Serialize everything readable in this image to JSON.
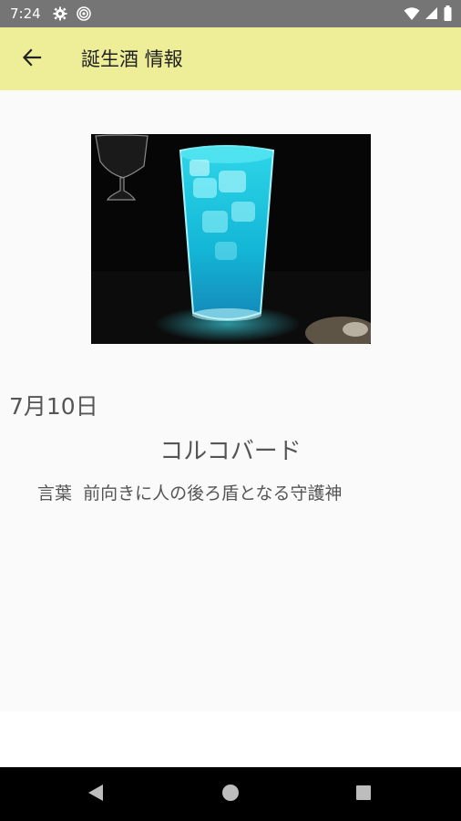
{
  "status_bar": {
    "time": "7:24",
    "icons_left": [
      "settings-gear-icon",
      "location-target-icon"
    ],
    "icons_right": [
      "wifi-icon",
      "cellular-signal-icon",
      "battery-icon"
    ]
  },
  "app_bar": {
    "title": "誕生酒 情報",
    "back_icon": "arrow-back-icon",
    "background": "#eeee99"
  },
  "content": {
    "date": "7月10日",
    "cocktail_name": "コルコバード",
    "meaning_label": "言葉",
    "meaning_text": "前向きに人の後ろ盾となる守護神",
    "photo_alt": "blue cocktail in tall glass"
  },
  "nav_bar": {
    "buttons": [
      "back-triangle-icon",
      "home-circle-icon",
      "recents-square-icon"
    ]
  }
}
